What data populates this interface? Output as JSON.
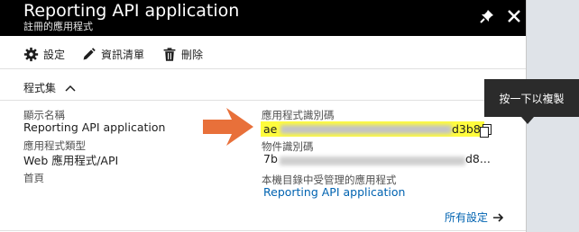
{
  "header": {
    "title": "Reporting API application",
    "subtitle": "註冊的應用程式"
  },
  "toolbar": {
    "settings_label": "設定",
    "manifest_label": "資訊清單",
    "delete_label": "刪除"
  },
  "essentials": {
    "toggle_label": "程式集",
    "display_name_label": "顯示名稱",
    "display_name_value": "Reporting API application",
    "app_type_label": "應用程式類型",
    "app_type_value": "Web 應用程式/API",
    "home_label": "首頁",
    "app_id_label": "應用程式識別碼",
    "app_id_value_prefix": "ae",
    "app_id_value_suffix": "d3b8",
    "object_id_label": "物件識別碼",
    "object_id_value_prefix": "7b",
    "object_id_value_suffix": "d8...",
    "managed_app_label": "本機目錄中受管理的應用程式",
    "managed_app_link": "Reporting API application"
  },
  "tooltip": {
    "text": "按一下以複製"
  },
  "footer": {
    "all_settings_label": "所有設定"
  },
  "colors": {
    "header_bg": "#000000",
    "highlight": "#fffc3e",
    "link": "#0063b1",
    "arrow": "#e8703a",
    "tooltip_bg": "#2b2b2b"
  },
  "icons": [
    "pin-icon",
    "close-icon",
    "gear-icon",
    "pencil-icon",
    "trash-icon",
    "chevron-up-icon",
    "copy-icon",
    "arrow-right-icon"
  ]
}
